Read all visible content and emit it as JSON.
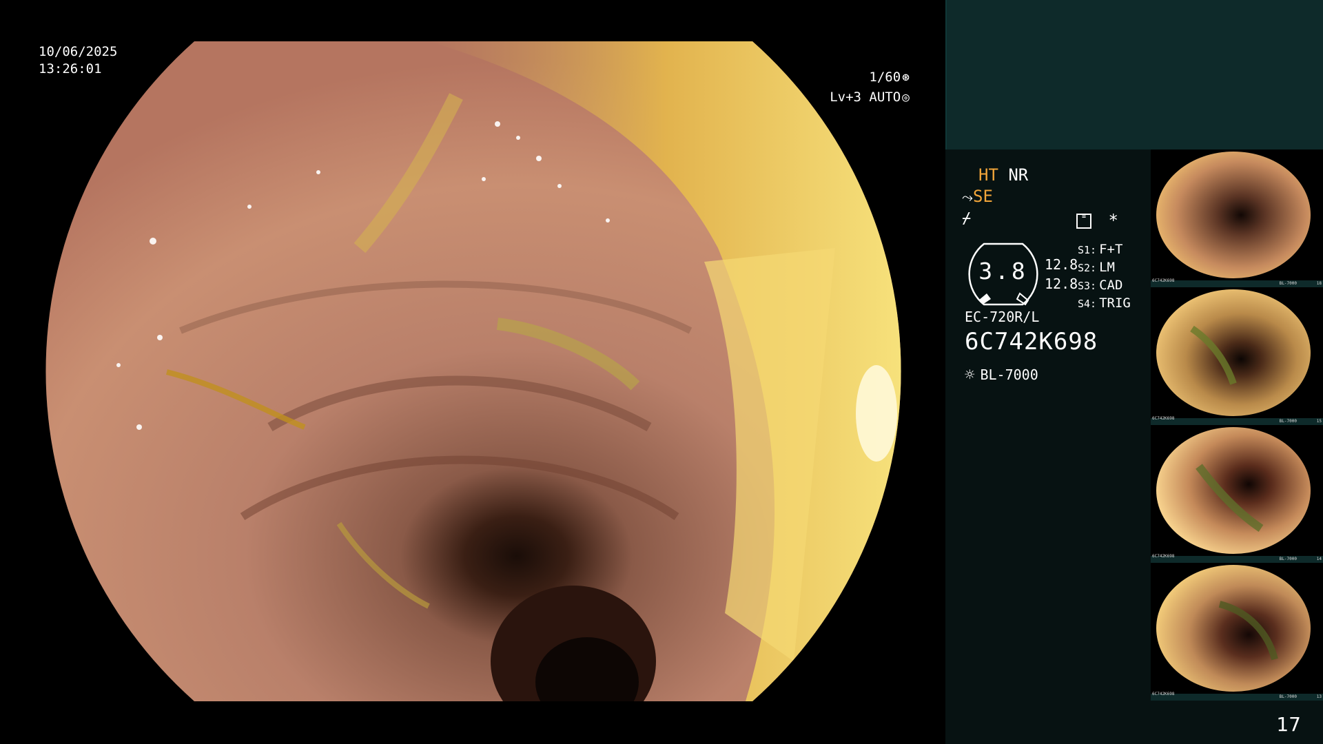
{
  "main": {
    "date": "10/06/2025",
    "time": "13:26:01",
    "shutter": "1/60",
    "shutter_icon": "aperture-icon",
    "iris": "Lv+3 AUTO",
    "iris_icon": "iris-icon"
  },
  "panel": {
    "mode_ht": "HT",
    "mode_nr": "NR",
    "mode_se": "SE",
    "gauge_value": "3.8",
    "level_1": "12.8",
    "level_2": "12.8",
    "switches": [
      {
        "key": "S1:",
        "val": "F+T"
      },
      {
        "key": "S2:",
        "val": "LM"
      },
      {
        "key": "S3:",
        "val": "CAD"
      },
      {
        "key": "S4:",
        "val": "TRIG"
      }
    ],
    "asterisk": "*",
    "scope_model": "EC-720R/L",
    "serial": "6C742K698",
    "light_source": "BL-7000"
  },
  "thumbnails": [
    {
      "id": "6C742K698",
      "src": "BL-7000",
      "num": "18"
    },
    {
      "id": "6C742K698",
      "src": "BL-7000",
      "num": "15"
    },
    {
      "id": "6C742K698",
      "src": "BL-7000",
      "num": "14"
    },
    {
      "id": "6C742K698",
      "src": "BL-7000",
      "num": "13"
    }
  ],
  "page_number": "17",
  "colors": {
    "panel_bg": "#071212",
    "panel_top": "#0e2a2a",
    "accent_orange": "#f2a53a",
    "mucosa": "#c98f72"
  }
}
